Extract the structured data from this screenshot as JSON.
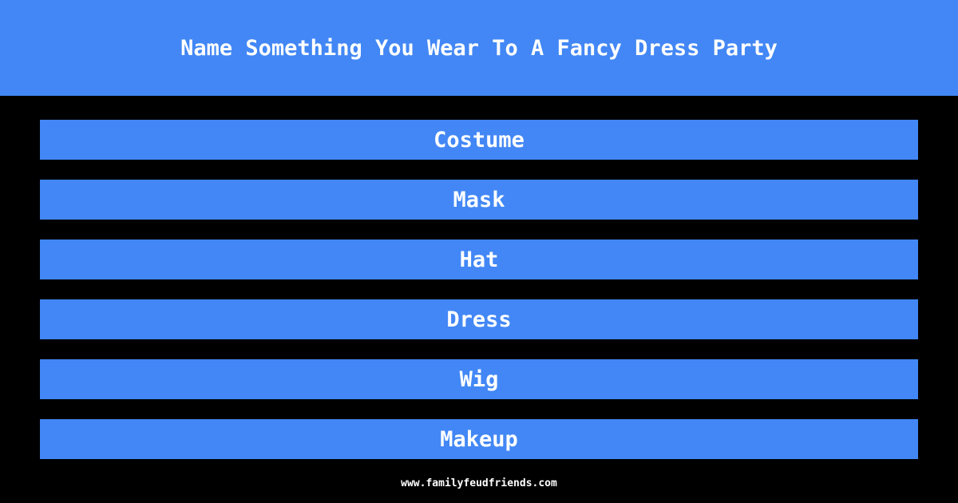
{
  "question": "Name Something You Wear To A Fancy Dress Party",
  "answers": [
    "Costume",
    "Mask",
    "Hat",
    "Dress",
    "Wig",
    "Makeup"
  ],
  "footer": "www.familyfeudfriends.com",
  "colors": {
    "accent": "#4287f5",
    "background": "#000000",
    "text": "#ffffff"
  }
}
